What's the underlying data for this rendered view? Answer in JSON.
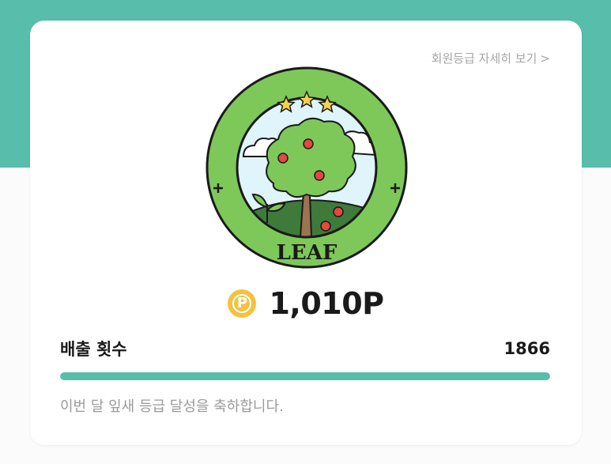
{
  "header": {
    "detail_link_label": "회원등급 자세히 보기",
    "detail_link_chevron": ">"
  },
  "badge": {
    "icon": "leaf-grade-badge-icon",
    "label": "LEAF",
    "stars": 3
  },
  "points": {
    "coin_letter": "P",
    "value": "1,010P"
  },
  "discharge": {
    "label": "배출 횟수",
    "count": "1866",
    "progress": 1.0
  },
  "message": "이번 달 잎새 등급 달성을 축하합니다.",
  "colors": {
    "accent": "#58bdab",
    "coin": "#f3c242",
    "badge_ring": "#7ec85a",
    "apple": "#e5483c"
  }
}
